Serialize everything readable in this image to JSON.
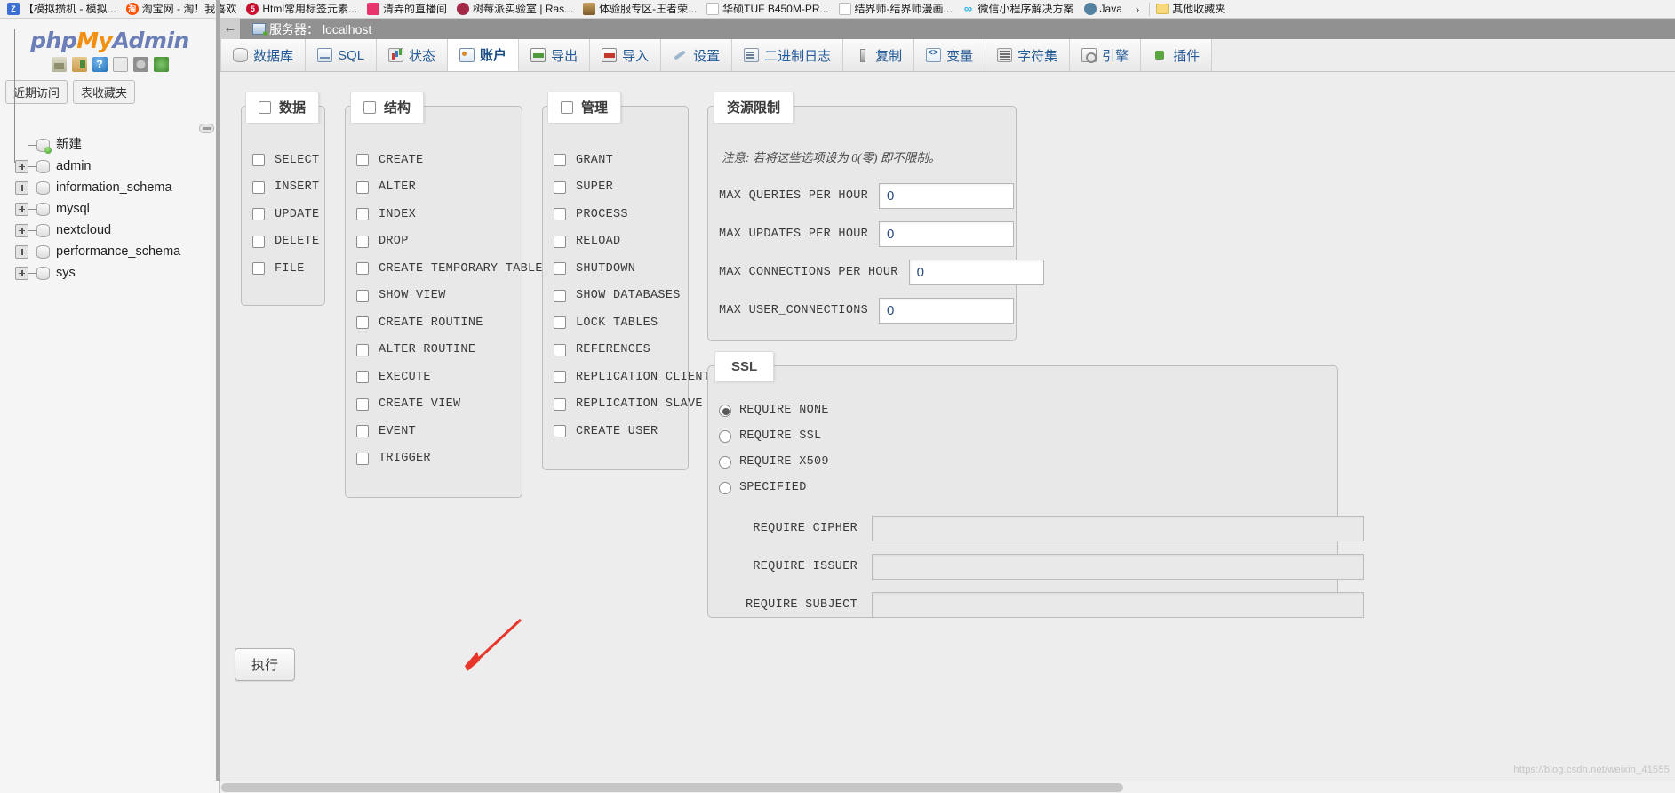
{
  "browser": {
    "bookmarks": [
      {
        "label": "【模拟攒机 - 模拟...",
        "icon": "z-logo-icon",
        "color": "#3b6fd4"
      },
      {
        "label": "淘宝网 - 淘！我喜欢",
        "icon": "taobao-icon",
        "color": "#ff5000"
      },
      {
        "label": "Html常用标签元素...",
        "icon": "blue-dot-icon",
        "color": "#c8102e"
      },
      {
        "label": "清弄的直播间",
        "icon": "pink-square-icon",
        "color": "#e8336d"
      },
      {
        "label": "树莓派实验室 | Ras...",
        "icon": "raspberry-icon",
        "color": "#a22846"
      },
      {
        "label": "体验服专区-王者荣...",
        "icon": "honor-king-icon",
        "color": "#8a6d3b"
      },
      {
        "label": "华硕TUF B450M-PR...",
        "icon": "page-icon",
        "color": "#bdbdbd"
      },
      {
        "label": "结界师-结界师漫画...",
        "icon": "page-icon",
        "color": "#bdbdbd"
      },
      {
        "label": "微信小程序解决方案",
        "icon": "wechat-icon",
        "color": "#1aad19"
      },
      {
        "label": "Java",
        "icon": "java-icon",
        "color": "#5382a1"
      }
    ],
    "overflow_chevron": "›",
    "other_bookmarks": "其他收藏夹"
  },
  "sidebar": {
    "logo": {
      "php": "php",
      "my": "My",
      "admin": "Admin"
    },
    "icons": [
      "home-icon",
      "logout-icon",
      "help-icon",
      "docs-icon",
      "settings-icon",
      "reload-icon"
    ],
    "quick_tabs": [
      {
        "label": "近期访问",
        "name": "recent-tab"
      },
      {
        "label": "表收藏夹",
        "name": "favorites-tab"
      }
    ],
    "tree": [
      {
        "label": "新建",
        "expandable": false,
        "new": true
      },
      {
        "label": "admin",
        "expandable": true,
        "new": false
      },
      {
        "label": "information_schema",
        "expandable": true,
        "new": false
      },
      {
        "label": "mysql",
        "expandable": true,
        "new": false
      },
      {
        "label": "nextcloud",
        "expandable": true,
        "new": false
      },
      {
        "label": "performance_schema",
        "expandable": true,
        "new": false
      },
      {
        "label": "sys",
        "expandable": true,
        "new": false
      }
    ]
  },
  "server_bar": {
    "back_arrow": "←",
    "label": "服务器：",
    "value": "localhost"
  },
  "tabs": [
    {
      "label": "数据库",
      "icon": "database-icon",
      "active": false
    },
    {
      "label": "SQL",
      "icon": "sql-icon",
      "active": false
    },
    {
      "label": "状态",
      "icon": "status-icon",
      "active": false
    },
    {
      "label": "账户",
      "icon": "account-icon",
      "active": true
    },
    {
      "label": "导出",
      "icon": "export-icon",
      "active": false
    },
    {
      "label": "导入",
      "icon": "import-icon",
      "active": false
    },
    {
      "label": "设置",
      "icon": "settings-wrench-icon",
      "active": false
    },
    {
      "label": "二进制日志",
      "icon": "binlog-icon",
      "active": false
    },
    {
      "label": "复制",
      "icon": "replication-icon",
      "active": false
    },
    {
      "label": "变量",
      "icon": "variables-icon",
      "active": false
    },
    {
      "label": "字符集",
      "icon": "charset-icon",
      "active": false
    },
    {
      "label": "引擎",
      "icon": "engine-icon",
      "active": false
    },
    {
      "label": "插件",
      "icon": "plugin-icon",
      "active": false
    }
  ],
  "privileges": {
    "data": {
      "legend": "数据",
      "items": [
        "SELECT",
        "INSERT",
        "UPDATE",
        "DELETE",
        "FILE"
      ]
    },
    "structure": {
      "legend": "结构",
      "items": [
        "CREATE",
        "ALTER",
        "INDEX",
        "DROP",
        "CREATE TEMPORARY TABLES",
        "SHOW VIEW",
        "CREATE ROUTINE",
        "ALTER ROUTINE",
        "EXECUTE",
        "CREATE VIEW",
        "EVENT",
        "TRIGGER"
      ]
    },
    "administration": {
      "legend": "管理",
      "items": [
        "GRANT",
        "SUPER",
        "PROCESS",
        "RELOAD",
        "SHUTDOWN",
        "SHOW DATABASES",
        "LOCK TABLES",
        "REFERENCES",
        "REPLICATION CLIENT",
        "REPLICATION SLAVE",
        "CREATE USER"
      ]
    }
  },
  "resource_limits": {
    "legend": "资源限制",
    "note": "注意: 若将这些选项设为 0(零) 即不限制。",
    "fields": [
      {
        "label": "MAX QUERIES PER HOUR",
        "value": "0"
      },
      {
        "label": "MAX UPDATES PER HOUR",
        "value": "0"
      },
      {
        "label": "MAX CONNECTIONS PER HOUR",
        "value": "0"
      },
      {
        "label": "MAX USER_CONNECTIONS",
        "value": "0"
      }
    ]
  },
  "ssl": {
    "legend": "SSL",
    "options": [
      {
        "label": "REQUIRE NONE",
        "checked": true
      },
      {
        "label": "REQUIRE SSL",
        "checked": false
      },
      {
        "label": "REQUIRE X509",
        "checked": false
      },
      {
        "label": "SPECIFIED",
        "checked": false
      }
    ],
    "text_fields": [
      {
        "label": "REQUIRE CIPHER",
        "value": ""
      },
      {
        "label": "REQUIRE ISSUER",
        "value": ""
      },
      {
        "label": "REQUIRE SUBJECT",
        "value": ""
      }
    ]
  },
  "footer": {
    "execute_button": "执行",
    "watermark": "https://blog.csdn.net/weixin_41555"
  }
}
